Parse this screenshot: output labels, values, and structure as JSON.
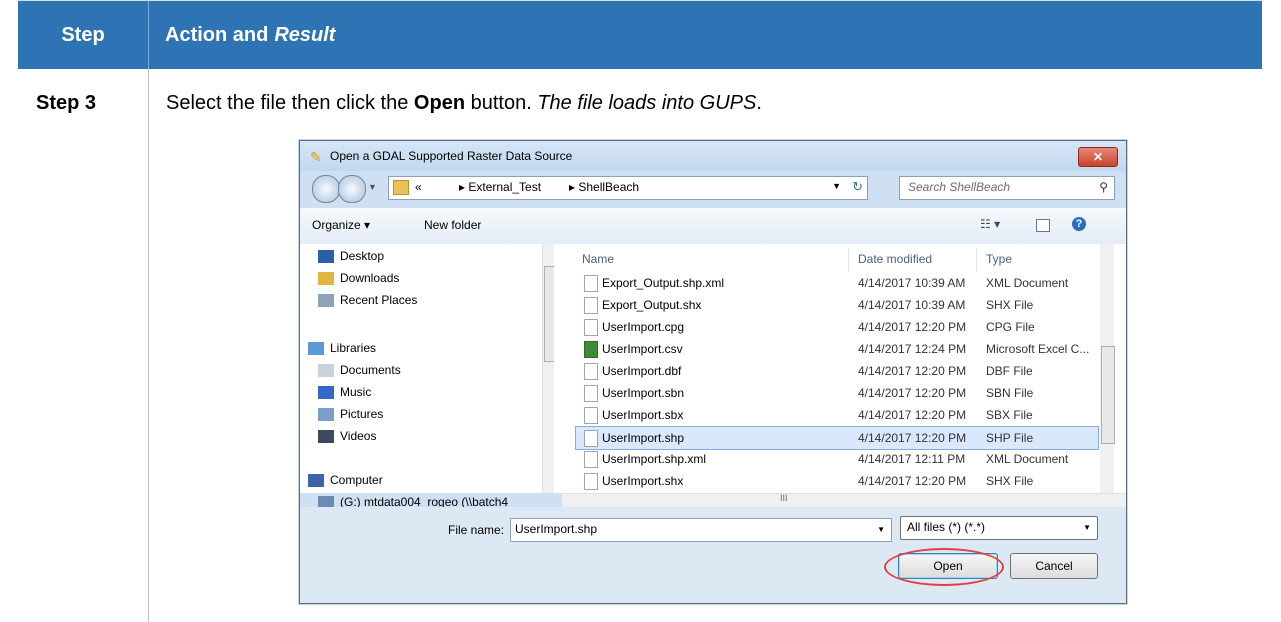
{
  "table": {
    "header_step": "Step",
    "header_action": "Action and",
    "header_result": "Result",
    "step_label": "Step 3",
    "instruction_prefix": "Select the file then click the ",
    "instruction_bold": "Open",
    "instruction_middle": " button. ",
    "instruction_italic": "The file loads into GUPS",
    "instruction_suffix": "."
  },
  "dialog": {
    "title": "Open a GDAL Supported Raster Data Source",
    "close_glyph": "✕",
    "address": {
      "chevron": "«",
      "crumb1": "▸ External_Test",
      "crumb2": "▸ ShellBeach",
      "refresh_glyph": "↻"
    },
    "search_placeholder": "Search ShellBeach",
    "toolbar": {
      "organize": "Organize ▾",
      "new_folder": "New folder",
      "view_glyph": "☷ ▾",
      "help_glyph": "?"
    },
    "nav_items": [
      {
        "label": "Desktop",
        "icon": "desktop-icon",
        "color": "#2d5fa8"
      },
      {
        "label": "Downloads",
        "icon": "downloads-icon",
        "color": "#e0b640"
      },
      {
        "label": "Recent Places",
        "icon": "recent-places-icon",
        "color": "#8ea2b8"
      },
      {
        "label": "Libraries",
        "icon": "libraries-icon",
        "color": "#5a9bd5"
      },
      {
        "label": "Documents",
        "icon": "documents-icon",
        "color": "#c9d3de"
      },
      {
        "label": "Music",
        "icon": "music-icon",
        "color": "#3468c4"
      },
      {
        "label": "Pictures",
        "icon": "pictures-icon",
        "color": "#7aa0c8"
      },
      {
        "label": "Videos",
        "icon": "videos-icon",
        "color": "#3b4a5c"
      },
      {
        "label": "Computer",
        "icon": "computer-icon",
        "color": "#3a66a8"
      },
      {
        "label": "(G:) mtdata004_rogeo (\\\\batch4",
        "icon": "network-drive-icon",
        "color": "#6b8bb0"
      }
    ],
    "columns": {
      "name": "Name",
      "date": "Date modified",
      "type": "Type"
    },
    "files": [
      {
        "name": "Export_Output.shp.xml",
        "date": "4/14/2017 10:39 AM",
        "type": "XML Document",
        "excel": false,
        "selected": false
      },
      {
        "name": "Export_Output.shx",
        "date": "4/14/2017 10:39 AM",
        "type": "SHX File",
        "excel": false,
        "selected": false
      },
      {
        "name": "UserImport.cpg",
        "date": "4/14/2017 12:20 PM",
        "type": "CPG File",
        "excel": false,
        "selected": false
      },
      {
        "name": "UserImport.csv",
        "date": "4/14/2017 12:24 PM",
        "type": "Microsoft Excel C...",
        "excel": true,
        "selected": false
      },
      {
        "name": "UserImport.dbf",
        "date": "4/14/2017 12:20 PM",
        "type": "DBF File",
        "excel": false,
        "selected": false
      },
      {
        "name": "UserImport.sbn",
        "date": "4/14/2017 12:20 PM",
        "type": "SBN File",
        "excel": false,
        "selected": false
      },
      {
        "name": "UserImport.sbx",
        "date": "4/14/2017 12:20 PM",
        "type": "SBX File",
        "excel": false,
        "selected": false
      },
      {
        "name": "UserImport.shp",
        "date": "4/14/2017 12:20 PM",
        "type": "SHP File",
        "excel": false,
        "selected": true
      },
      {
        "name": "UserImport.shp.xml",
        "date": "4/14/2017 12:11 PM",
        "type": "XML Document",
        "excel": false,
        "selected": false
      },
      {
        "name": "UserImport.shx",
        "date": "4/14/2017 12:20 PM",
        "type": "SHX File",
        "excel": false,
        "selected": false
      }
    ],
    "file_name_label": "File name:",
    "file_name_value": "UserImport.shp",
    "file_type_value": "All files (*) (*.*)",
    "open_label": "Open",
    "cancel_label": "Cancel",
    "hscroll_thumb": "III"
  }
}
